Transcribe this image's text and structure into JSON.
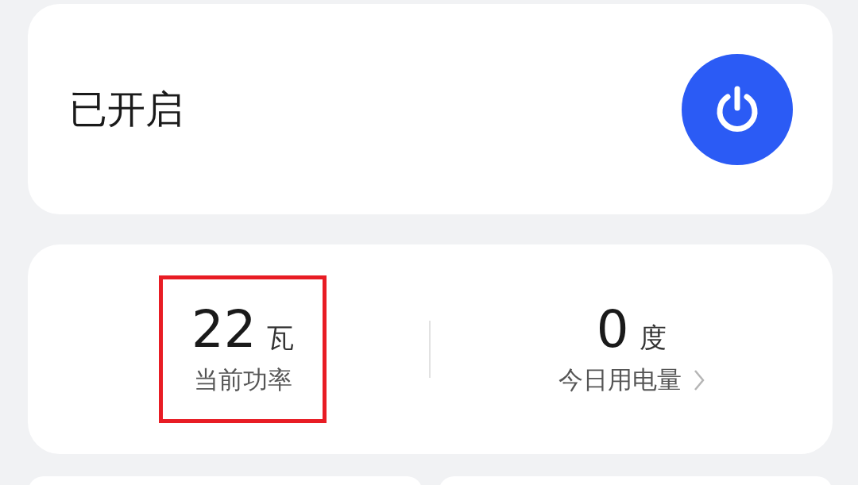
{
  "status_card": {
    "label": "已开启",
    "power_on": true
  },
  "stats": [
    {
      "value": "22",
      "unit": "瓦",
      "label": "当前功率",
      "highlighted": true,
      "has_link": false
    },
    {
      "value": "0",
      "unit": "度",
      "label": "今日用电量",
      "highlighted": false,
      "has_link": true
    }
  ]
}
